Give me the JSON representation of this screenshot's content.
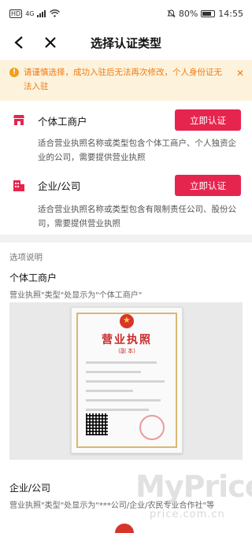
{
  "status_bar": {
    "network": "HD",
    "signal": "4G",
    "battery": "80%",
    "time": "14:55"
  },
  "nav": {
    "title": "选择认证类型"
  },
  "notice": {
    "text": "请谨慎选择，成功入驻后无法再次修改，个人身份证无法入驻"
  },
  "options": [
    {
      "title": "个体工商户",
      "button": "立即认证",
      "description": "适合营业执照名称或类型包含个体工商户、个人独资企业的公司，需要提供营业执照"
    },
    {
      "title": "企业/公司",
      "button": "立即认证",
      "description": "适合营业执照名称或类型包含有限制责任公司、股份公司，需要提供营业执照"
    }
  ],
  "explanation": {
    "label": "选项说明",
    "items": [
      {
        "title": "个体工商户",
        "note": "营业执照\"类型\"处显示为\"个体工商户\""
      },
      {
        "title": "企业/公司",
        "note": "营业执照\"类型\"处显示为\"***公司/企业/农民专业合作社\"等"
      }
    ]
  },
  "license": {
    "heading": "营业执照",
    "sub": "(副 本)"
  },
  "watermark": {
    "brand": "MyPrice",
    "domain": "price.com.cn"
  },
  "colors": {
    "accent": "#e6254e",
    "notice_bg": "#fdf3dc",
    "notice_text": "#f07a12"
  }
}
